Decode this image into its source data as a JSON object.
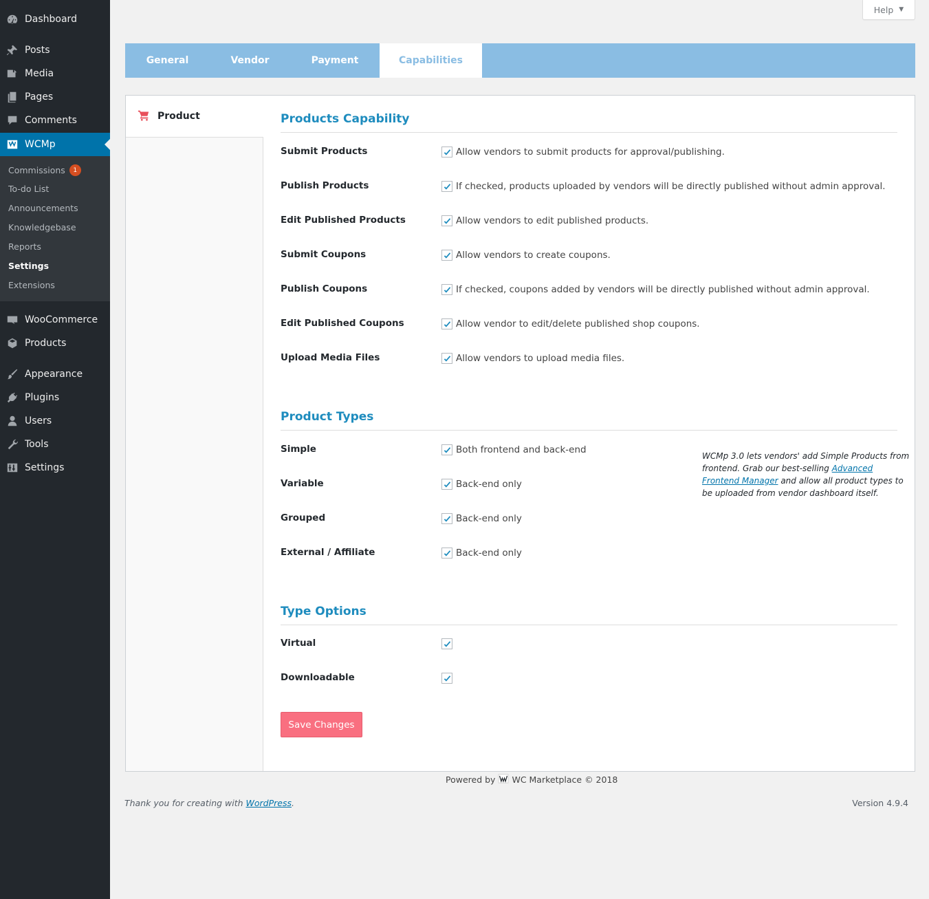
{
  "sidebar": {
    "items": [
      {
        "label": "Dashboard",
        "icon": "dashboard-icon"
      },
      {
        "label": "Posts",
        "icon": "pin-icon"
      },
      {
        "label": "Media",
        "icon": "media-icon"
      },
      {
        "label": "Pages",
        "icon": "pages-icon"
      },
      {
        "label": "Comments",
        "icon": "comment-icon"
      },
      {
        "label": "WCMp",
        "icon": "wcmp-icon"
      },
      {
        "label": "WooCommerce",
        "icon": "woocommerce-icon"
      },
      {
        "label": "Products",
        "icon": "box-icon"
      },
      {
        "label": "Appearance",
        "icon": "brush-icon"
      },
      {
        "label": "Plugins",
        "icon": "plug-icon"
      },
      {
        "label": "Users",
        "icon": "user-icon"
      },
      {
        "label": "Tools",
        "icon": "wrench-icon"
      },
      {
        "label": "Settings",
        "icon": "sliders-icon"
      }
    ],
    "submenu": [
      {
        "label": "Commissions",
        "badge": "1"
      },
      {
        "label": "To-do List"
      },
      {
        "label": "Announcements"
      },
      {
        "label": "Knowledgebase"
      },
      {
        "label": "Reports"
      },
      {
        "label": "Settings"
      },
      {
        "label": "Extensions"
      }
    ]
  },
  "help": {
    "label": "Help"
  },
  "tabs": [
    {
      "label": "General"
    },
    {
      "label": "Vendor"
    },
    {
      "label": "Payment"
    },
    {
      "label": "Capabilities",
      "active": true
    }
  ],
  "section_nav": {
    "label": "Product",
    "icon": "cart-icon"
  },
  "sections": {
    "capability": {
      "title": "Products Capability",
      "rows": [
        {
          "label": "Submit Products",
          "text": "Allow vendors to submit products for approval/publishing.",
          "checked": true
        },
        {
          "label": "Publish Products",
          "text": "If checked, products uploaded by vendors will be directly published without admin approval.",
          "checked": true
        },
        {
          "label": "Edit Published Products",
          "text": "Allow vendors to edit published products.",
          "checked": true
        },
        {
          "label": "Submit Coupons",
          "text": "Allow vendors to create coupons.",
          "checked": true
        },
        {
          "label": "Publish Coupons",
          "text": "If checked, coupons added by vendors will be directly published without admin approval.",
          "checked": true
        },
        {
          "label": "Edit Published Coupons",
          "text": "Allow vendor to edit/delete published shop coupons.",
          "checked": true
        },
        {
          "label": "Upload Media Files",
          "text": "Allow vendors to upload media files.",
          "checked": true
        }
      ]
    },
    "types": {
      "title": "Product Types",
      "rows": [
        {
          "label": "Simple",
          "text": "Both frontend and back-end",
          "checked": true
        },
        {
          "label": "Variable",
          "text": "Back-end only",
          "checked": true
        },
        {
          "label": "Grouped",
          "text": "Back-end only",
          "checked": true
        },
        {
          "label": "External / Affiliate",
          "text": "Back-end only",
          "checked": true
        }
      ],
      "promo": {
        "before": "WCMp 3.0 lets vendors' add Simple Products from frontend. Grab our best-selling ",
        "link": "Advanced Frontend Manager",
        "after": " and allow all product types to be uploaded from vendor dashboard itself."
      }
    },
    "options": {
      "title": "Type Options",
      "rows": [
        {
          "label": "Virtual",
          "checked": true
        },
        {
          "label": "Downloadable",
          "checked": true
        }
      ]
    }
  },
  "save_label": "Save Changes",
  "footer": {
    "powered_prefix": "Powered by",
    "powered_name": "WC Marketplace © 2018",
    "thanks_prefix": "Thank you for creating with ",
    "thanks_link": "WordPress",
    "thanks_suffix": ".",
    "version": "Version 4.9.4"
  },
  "colors": {
    "sidebar_bg": "#23282d",
    "active_menu": "#0073aa",
    "tab_bar": "#8abde3",
    "section_title": "#1e8cbe",
    "save_button": "#f96f80",
    "checkmark": "#1e8cbe"
  }
}
